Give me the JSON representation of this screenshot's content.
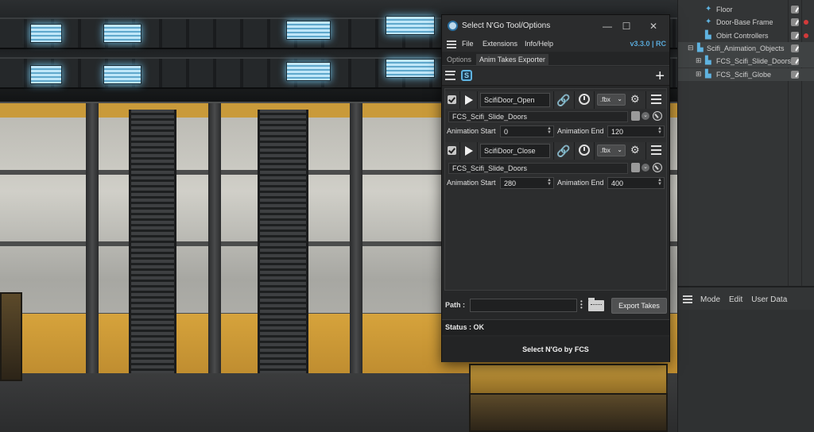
{
  "window": {
    "title": "Select N'Go Tool/Options",
    "minimize_icon": "minimize-icon",
    "maximize_icon": "maximize-icon",
    "close_icon": "close-icon"
  },
  "menu": {
    "items": [
      "File",
      "Extensions",
      "Info/Help"
    ],
    "version": "v3.3.0 | RC"
  },
  "tabs": [
    {
      "label": "Options",
      "active": false
    },
    {
      "label": "Anim Takes Exporter",
      "active": true
    }
  ],
  "takes": [
    {
      "checked": true,
      "name": "ScifiDoor_Open",
      "format": ".fbx",
      "object": "FCS_Scifi_Slide_Doors",
      "anim_start_label": "Animation Start",
      "anim_start": "0",
      "anim_end_label": "Animation End",
      "anim_end": "120"
    },
    {
      "checked": true,
      "name": "ScifiDoor_Close",
      "format": ".fbx",
      "object": "FCS_Scifi_Slide_Doors",
      "anim_start_label": "Animation Start",
      "anim_start": "280",
      "anim_end_label": "Animation End",
      "anim_end": "400"
    }
  ],
  "path": {
    "label": "Path :",
    "value": "",
    "export_label": "Export Takes"
  },
  "status": "Status : OK",
  "footer": "Select N'Go by FCS",
  "object_manager": {
    "items": [
      {
        "label": "Floor",
        "indent": 2
      },
      {
        "label": "Door-Base Frame",
        "indent": 2
      },
      {
        "label": "Obirt Controllers",
        "indent": 2
      },
      {
        "label": "Scifi_Animation_Objects",
        "indent": 1
      },
      {
        "label": "FCS_Scifi_Slide_Doors",
        "indent": 2
      },
      {
        "label": "FCS_Scifi_Globe",
        "indent": 2
      }
    ],
    "attr_menu": [
      "Mode",
      "Edit",
      "User Data"
    ]
  },
  "colors": {
    "accent": "#4fb2e8",
    "version": "#58a8d8",
    "panel": "#262728",
    "status_dot": "#d23a3a"
  }
}
